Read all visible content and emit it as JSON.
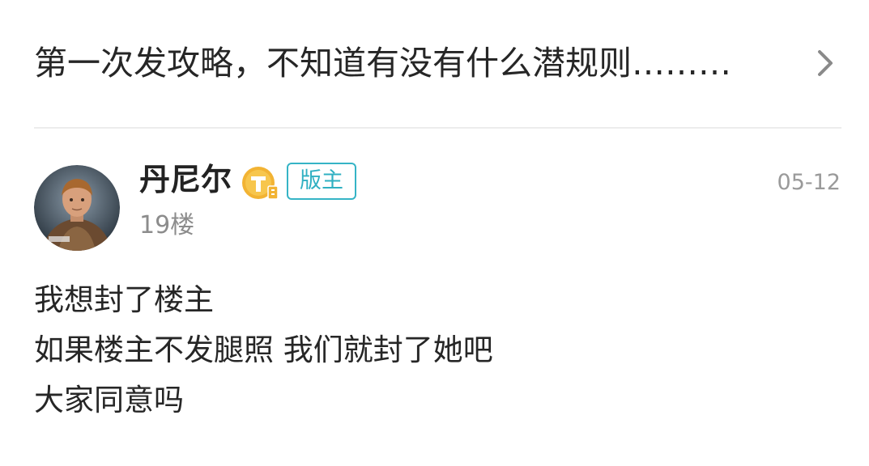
{
  "thread": {
    "title": "第一次发攻略，不知道有没有什么潜规则………",
    "chevron_icon": "chevron-right-icon"
  },
  "post": {
    "author": {
      "name": "丹尼尔",
      "avatar_icon": "avatar-portrait",
      "level_icon": "gold-t-level-badge",
      "role_badge": "版主"
    },
    "floor": "19楼",
    "date": "05-12",
    "body_lines": [
      "我想封了楼主",
      "如果楼主不发腿照 我们就封了她吧",
      "大家同意吗"
    ]
  },
  "colors": {
    "accent": "#35b4c6",
    "text": "#262626",
    "muted": "#8c8c8c",
    "divider": "#ececec",
    "badge_gold": "#f2b333"
  }
}
